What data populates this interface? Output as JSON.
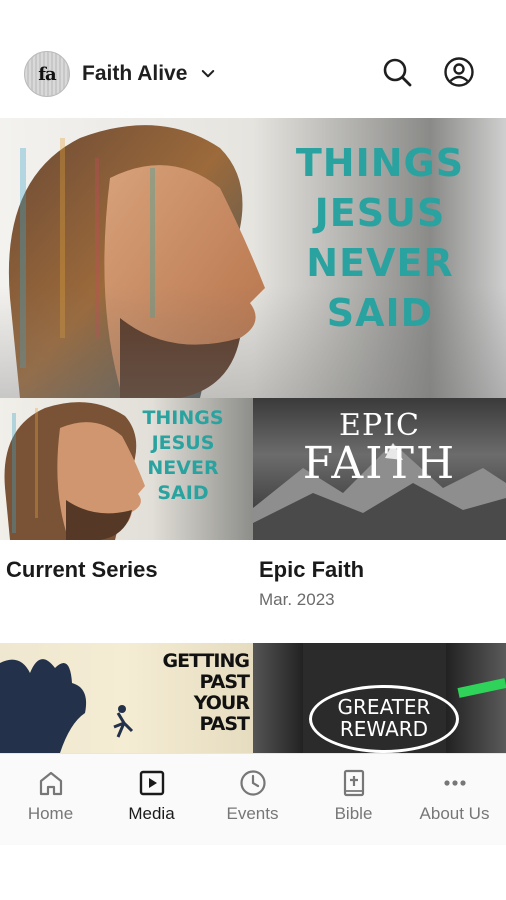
{
  "header": {
    "logo_text": "fa",
    "org_name": "Faith Alive",
    "icons": [
      "search-icon",
      "profile-icon",
      "chevron-down-icon"
    ]
  },
  "hero": {
    "title_lines": [
      "THINGS",
      "JESUS",
      "NEVER",
      "SAID"
    ]
  },
  "cards": [
    {
      "name": "Current Series",
      "date": "",
      "image_lines": [
        "THINGS",
        "JESUS",
        "NEVER",
        "SAID"
      ]
    },
    {
      "name": "Epic Faith",
      "date": "Mar. 2023",
      "image_lines": [
        "EPIC",
        "FAITH"
      ]
    },
    {
      "name": "",
      "date": "",
      "image_lines": [
        "GETTING",
        "PAST",
        "YOUR",
        "PAST"
      ]
    },
    {
      "name": "",
      "date": "",
      "image_lines": [
        "GREATER",
        "REWARD"
      ]
    }
  ],
  "nav": {
    "items": [
      {
        "label": "Home",
        "icon": "home-icon"
      },
      {
        "label": "Media",
        "icon": "media-icon",
        "active": true
      },
      {
        "label": "Events",
        "icon": "clock-icon"
      },
      {
        "label": "Bible",
        "icon": "bible-icon"
      },
      {
        "label": "About Us",
        "icon": "more-icon"
      }
    ]
  },
  "colors": {
    "accent_teal": "#2aa3a0",
    "active_nav": "#1a1a1a",
    "inactive_nav": "#777777"
  }
}
